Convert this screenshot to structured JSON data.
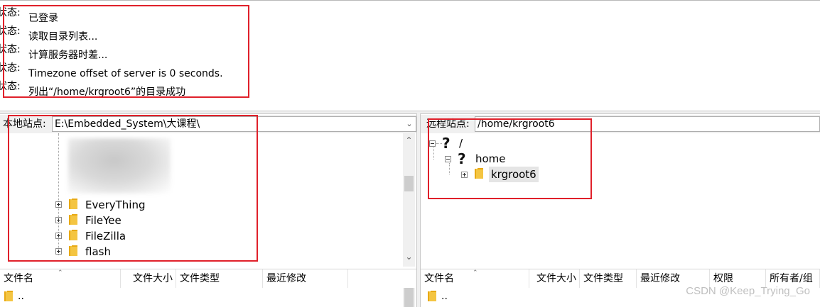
{
  "log": {
    "lines": [
      {
        "label": "状态:",
        "message": "已登录"
      },
      {
        "label": "状态:",
        "message": "读取目录列表..."
      },
      {
        "label": "状态:",
        "message": "计算服务器时差..."
      },
      {
        "label": "状态:",
        "message": "Timezone offset of server is 0 seconds."
      },
      {
        "label": "状态:",
        "message": "列出“/home/krgroot6”的目录成功"
      }
    ]
  },
  "local": {
    "site_label": "本地站点:",
    "path": "E:\\Embedded_System\\大课程\\",
    "tree_items": [
      "EveryThing",
      "FileYee",
      "FileZilla",
      "flash"
    ],
    "columns": [
      "文件名",
      "文件大小",
      "文件类型",
      "最近修改"
    ],
    "rows": [
      ".."
    ]
  },
  "remote": {
    "site_label": "远程站点:",
    "path": "/home/krgroot6",
    "tree": {
      "root": "/",
      "child": "home",
      "grandchild": "krgroot6"
    },
    "columns": [
      "文件名",
      "文件大小",
      "文件类型",
      "最近修改",
      "权限",
      "所有者/组"
    ],
    "rows": [
      ".."
    ]
  },
  "icons": {
    "folder": "folder-icon",
    "unknown": "question-folder-icon",
    "expand": "expand-plus-icon",
    "collapse": "collapse-minus-icon",
    "dropdown": "chevron-down-icon",
    "scroll_up": "chevron-up-icon",
    "scroll_down": "chevron-down-icon"
  },
  "watermark": "CSDN @Keep_Trying_Go",
  "colors": {
    "annotation": "#e0202a",
    "folder": "#f4c542"
  }
}
